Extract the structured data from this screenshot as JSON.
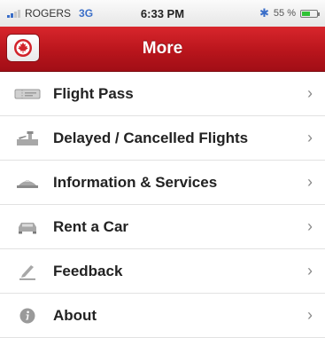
{
  "status": {
    "carrier": "ROGERS",
    "network": "3G",
    "time": "6:33 PM",
    "battery": "55 %",
    "battery_level": 0.55
  },
  "nav": {
    "title": "More"
  },
  "menu": {
    "items": [
      {
        "label": "Flight Pass",
        "icon": "ticket-icon"
      },
      {
        "label": "Delayed / Cancelled Flights",
        "icon": "airport-icon"
      },
      {
        "label": "Information & Services",
        "icon": "plane-info-icon"
      },
      {
        "label": "Rent a Car",
        "icon": "car-icon"
      },
      {
        "label": "Feedback",
        "icon": "pencil-icon"
      },
      {
        "label": "About",
        "icon": "info-icon"
      }
    ]
  },
  "colors": {
    "navbar": "#c41b22",
    "icon_gray": "#9a9a9a",
    "chevron": "#8a8a8a"
  }
}
